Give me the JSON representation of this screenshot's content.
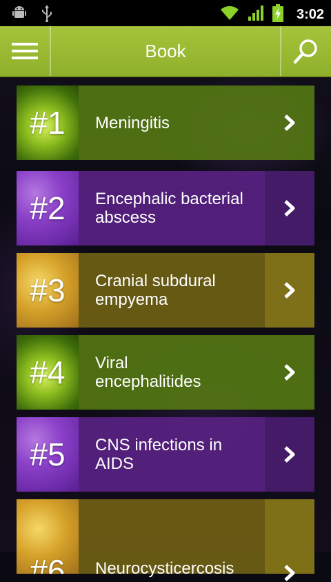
{
  "status_bar": {
    "time": "3:02",
    "left_icons": [
      "android-icon",
      "usb-icon"
    ],
    "right_icons": [
      "wifi-icon",
      "signal-icon",
      "battery-charging-icon"
    ]
  },
  "action_bar": {
    "title": "Book",
    "menu_icon": "hamburger-menu-icon",
    "search_icon": "search-icon",
    "color": "#9aba33"
  },
  "chapters": [
    {
      "number": "#1",
      "title": "Meningitis",
      "theme": "green"
    },
    {
      "number": "#2",
      "title": "Encephalic bacterial abscess",
      "theme": "purple"
    },
    {
      "number": "#3",
      "title": "Cranial subdural empyema",
      "theme": "yellow"
    },
    {
      "number": "#4",
      "title": "Viral encephalitides",
      "theme": "green"
    },
    {
      "number": "#5",
      "title": "CNS infections in AIDS",
      "theme": "purple"
    },
    {
      "number": "#6",
      "title": "Neurocysticercosis",
      "theme": "yellow"
    }
  ]
}
